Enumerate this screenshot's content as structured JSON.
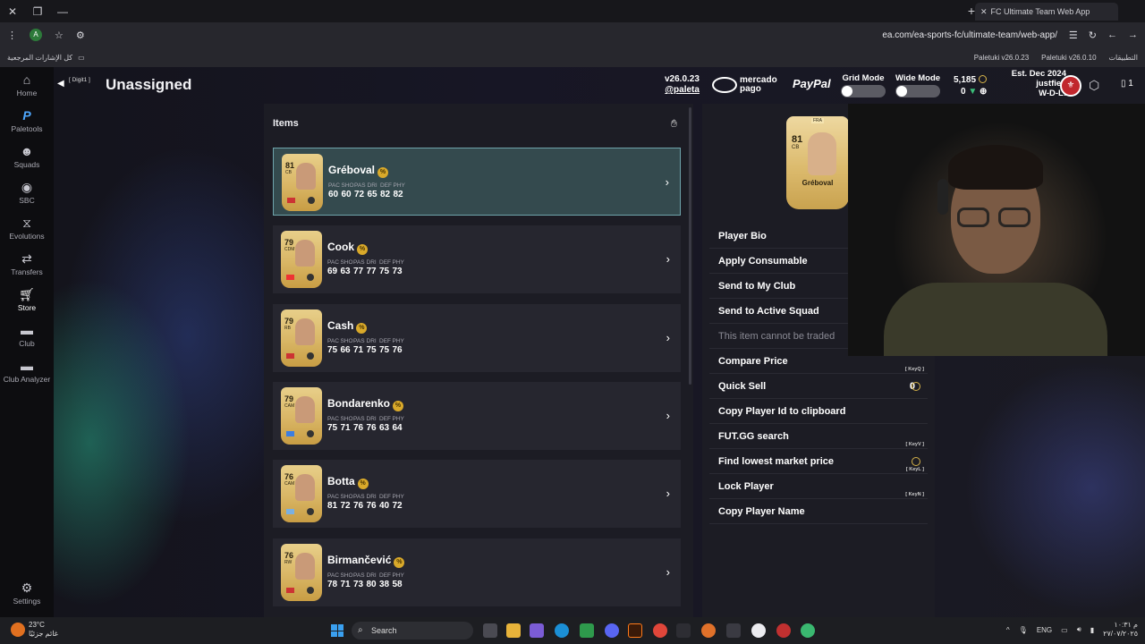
{
  "browser": {
    "tab_title": "FC Ultimate Team Web App",
    "url": "ea.com/ea-sports-fc/ultimate-team/web-app/",
    "bookmarks_left": "كل الإشارات المرجعية",
    "bookmarks_right": [
      "التطبيقات",
      "Paletuki v26.0.10",
      "Paletuki v26.0.23"
    ]
  },
  "sidebar": {
    "items": [
      {
        "label": "Home",
        "icon": "home-icon"
      },
      {
        "label": "Paletools",
        "icon": "paletools-icon"
      },
      {
        "label": "Squads",
        "icon": "squads-icon"
      },
      {
        "label": "SBC",
        "icon": "sbc-icon"
      },
      {
        "label": "Evolutions",
        "icon": "evolutions-icon"
      },
      {
        "label": "Transfers",
        "icon": "transfers-icon"
      },
      {
        "label": "Store",
        "icon": "cart-icon"
      },
      {
        "label": "Club",
        "icon": "club-icon"
      },
      {
        "label": "Club Analyzer",
        "icon": "club-analyzer-icon"
      },
      {
        "label": "Settings",
        "icon": "gear-icon"
      }
    ]
  },
  "header": {
    "digit": "[ Digit1 ]",
    "title": "Unassigned",
    "version": "v26.0.23",
    "author": "@paleta",
    "mercado_line1": "mercado",
    "mercado_line2": "pago",
    "paypal": "PayPal",
    "grid_mode": "Grid Mode",
    "wide_mode": "Wide Mode",
    "coins": "5,185",
    "points": "0",
    "est": "Est. Dec 2024",
    "user": "justfied",
    "wdl": "W-D-L:"
  },
  "items_panel": {
    "title": "Items",
    "stat_labels": [
      "PAC",
      "SHO",
      "PAS",
      "DRI",
      "DEF",
      "PHY"
    ],
    "players": [
      {
        "name": "Gréboval",
        "rating": "81",
        "position": "CB",
        "stats": [
          "60",
          "60",
          "72",
          "65",
          "82",
          "82"
        ]
      },
      {
        "name": "Cook",
        "rating": "79",
        "position": "CDM",
        "stats": [
          "69",
          "63",
          "77",
          "77",
          "75",
          "73"
        ]
      },
      {
        "name": "Cash",
        "rating": "79",
        "position": "RB",
        "stats": [
          "75",
          "66",
          "71",
          "75",
          "75",
          "76"
        ]
      },
      {
        "name": "Bondarenko",
        "rating": "79",
        "position": "CAM",
        "stats": [
          "75",
          "71",
          "76",
          "76",
          "63",
          "64"
        ]
      },
      {
        "name": "Botta",
        "rating": "76",
        "position": "CAM",
        "stats": [
          "81",
          "72",
          "76",
          "76",
          "40",
          "72"
        ]
      },
      {
        "name": "Birmančević",
        "rating": "76",
        "position": "RW",
        "stats": [
          "78",
          "71",
          "73",
          "80",
          "38",
          "58"
        ]
      }
    ]
  },
  "detail": {
    "card_rating": "81",
    "card_position": "CB",
    "card_name": "Gréboval",
    "menu": [
      {
        "label": "Player Bio"
      },
      {
        "label": "Apply Consumable"
      },
      {
        "label": "Send to My Club"
      },
      {
        "label": "Send to Active Squad"
      },
      {
        "label": "This item cannot be traded"
      },
      {
        "label": "Compare Price"
      },
      {
        "label": "Quick Sell",
        "key": "[ KeyQ ]",
        "value": "0"
      },
      {
        "label": "Copy Player Id to clipboard"
      },
      {
        "label": "FUT.GG search"
      },
      {
        "label": "Find lowest market price",
        "key": "[ KeyV ]"
      },
      {
        "label": "Lock Player",
        "key": "[ KeyL ]"
      },
      {
        "label": "Copy Player Name",
        "key": "[ KeyN ]"
      }
    ]
  },
  "taskbar": {
    "temp": "23°C",
    "weather_text": "غائم جزئيًا",
    "search": "Search",
    "lang": "ENG",
    "time": "م ١٠:٣١",
    "date": "٢٧/٠٧/٢٠٢٥"
  }
}
